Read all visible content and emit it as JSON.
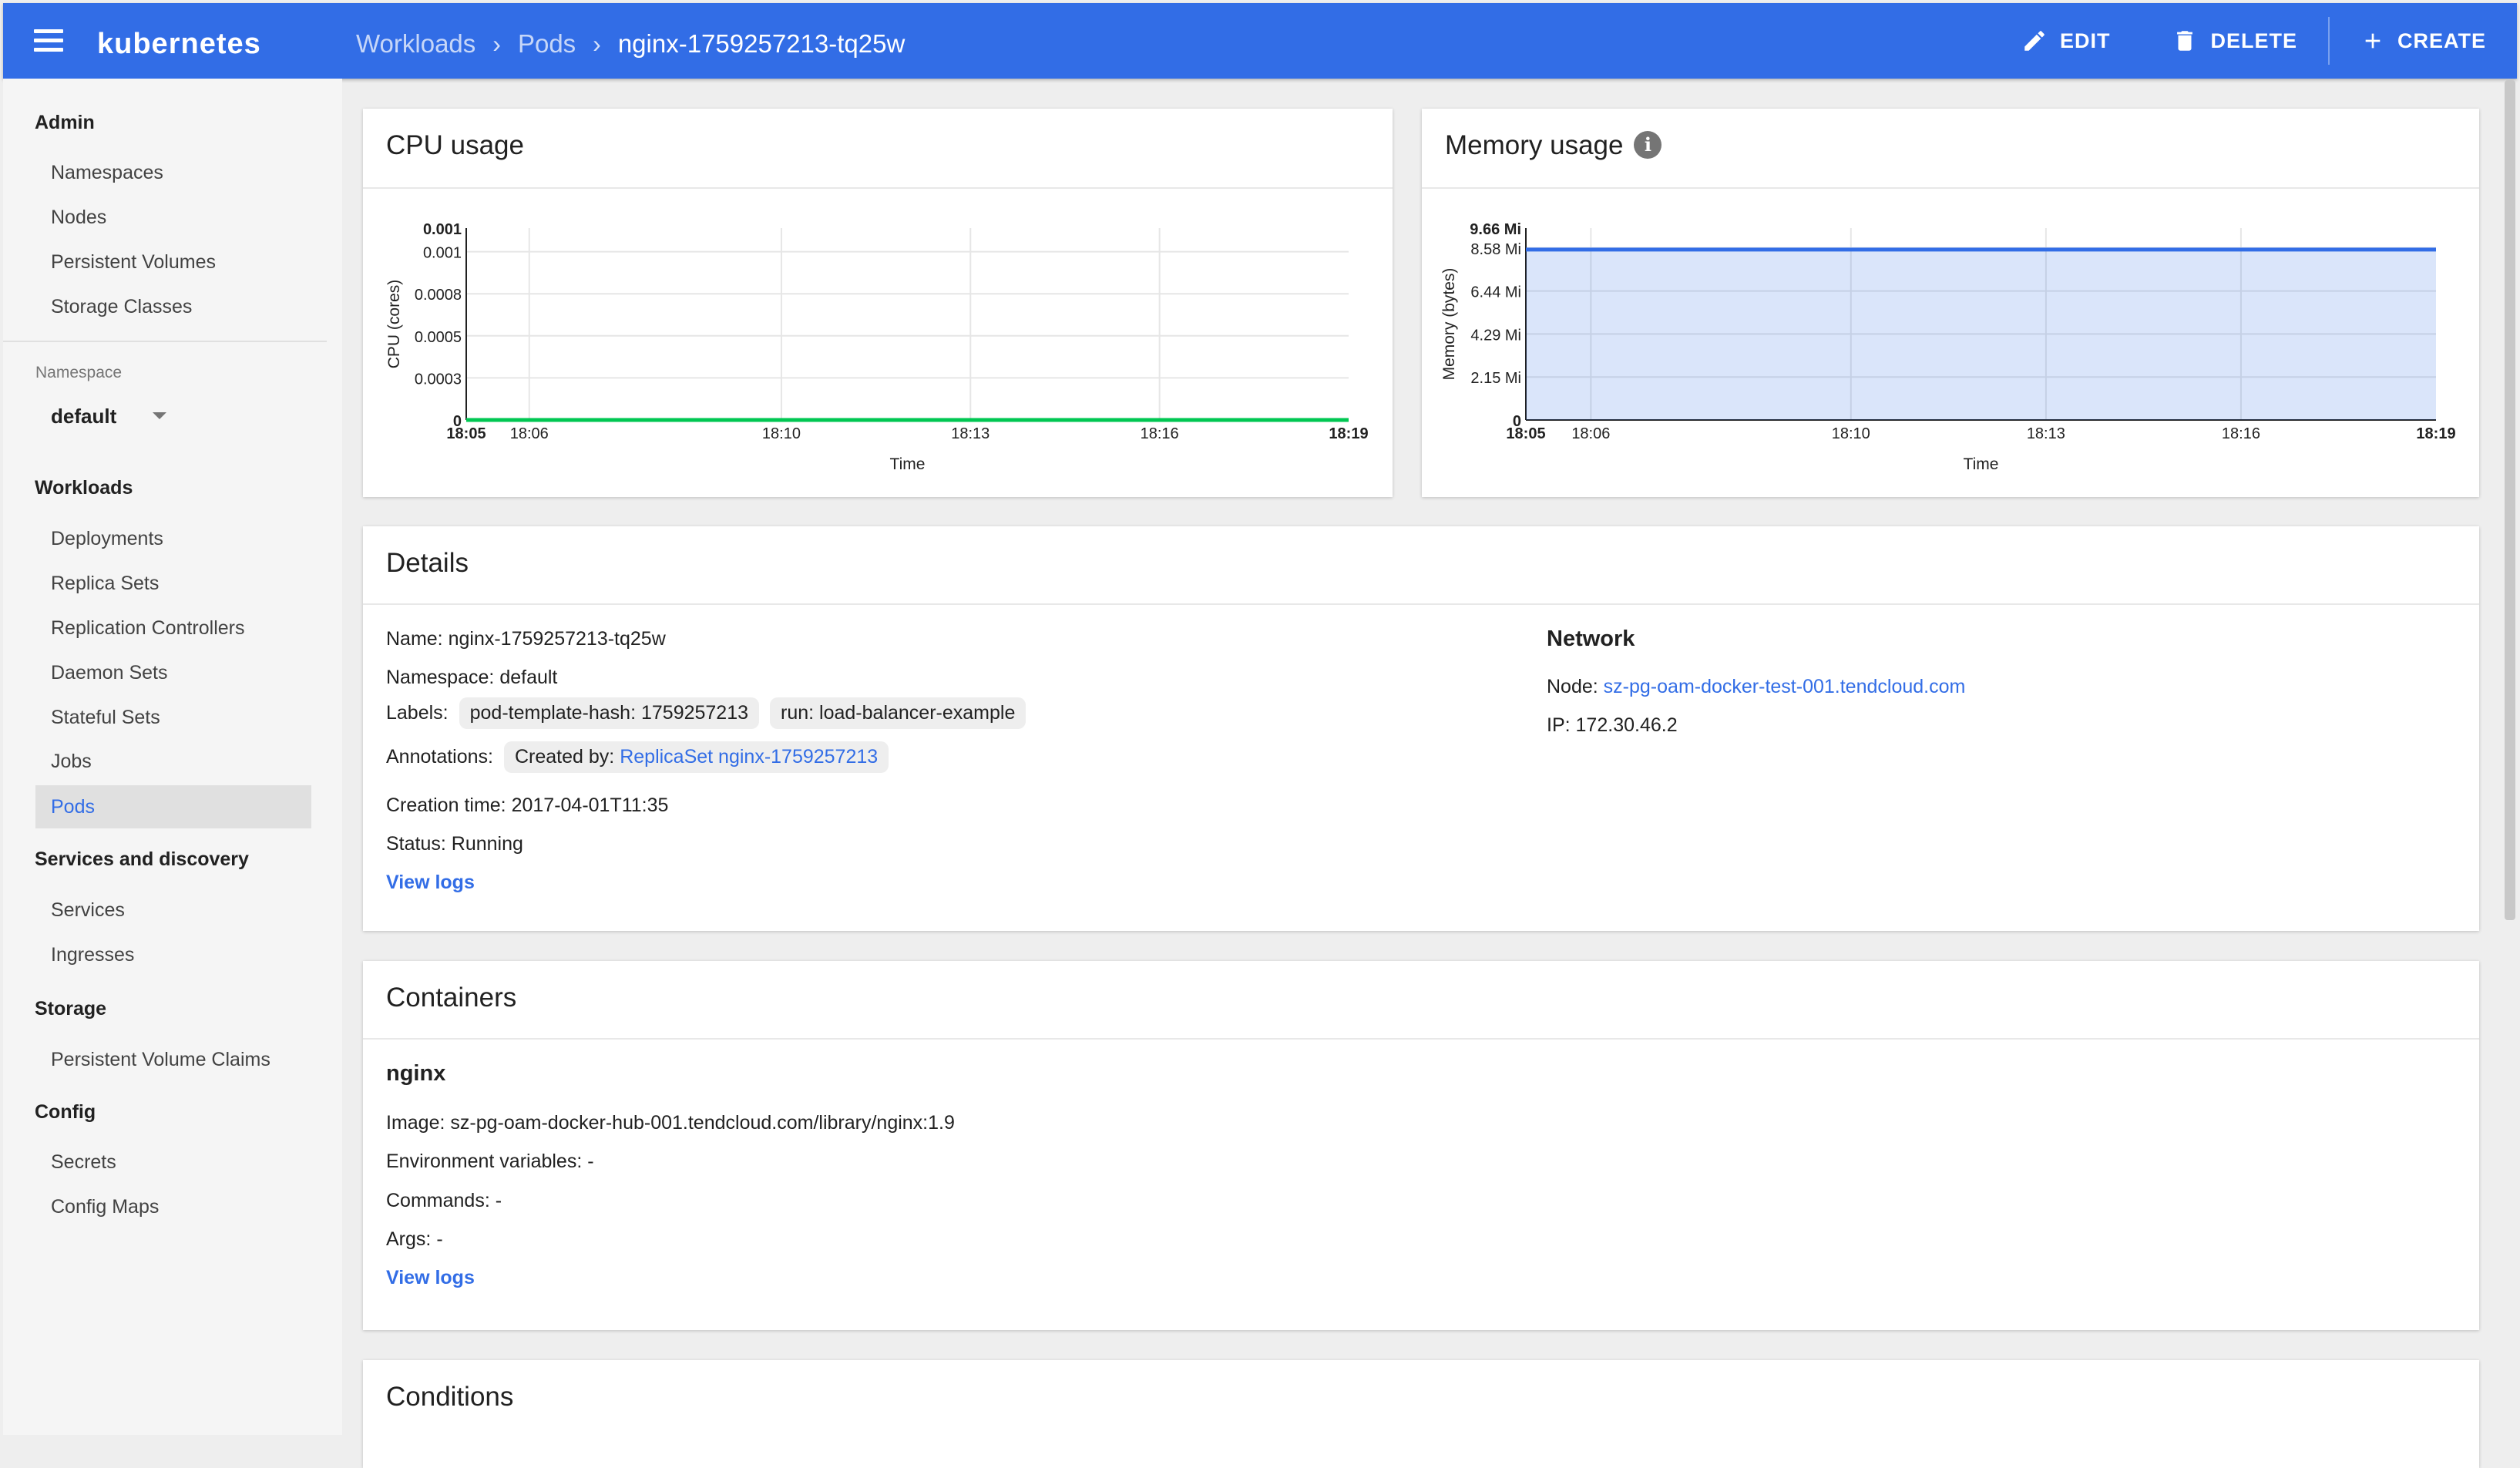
{
  "topbar": {
    "brand": "kubernetes",
    "breadcrumbs": [
      "Workloads",
      "Pods",
      "nginx-1759257213-tq25w"
    ],
    "actions": {
      "edit": "EDIT",
      "delete": "DELETE",
      "create": "CREATE"
    },
    "color": "#326de6"
  },
  "sidebar": {
    "admin": {
      "title": "Admin",
      "items": [
        "Namespaces",
        "Nodes",
        "Persistent Volumes",
        "Storage Classes"
      ]
    },
    "namespace": {
      "label": "Namespace",
      "value": "default"
    },
    "workloads": {
      "title": "Workloads",
      "items": [
        "Deployments",
        "Replica Sets",
        "Replication Controllers",
        "Daemon Sets",
        "Stateful Sets",
        "Jobs",
        "Pods"
      ],
      "active": "Pods"
    },
    "services": {
      "title": "Services and discovery",
      "items": [
        "Services",
        "Ingresses"
      ]
    },
    "storage": {
      "title": "Storage",
      "items": [
        "Persistent Volume Claims"
      ]
    },
    "config": {
      "title": "Config",
      "items": [
        "Secrets",
        "Config Maps"
      ]
    }
  },
  "chart_data": [
    {
      "type": "line",
      "title": "CPU usage",
      "xlabel": "Time",
      "ylabel": "CPU (cores)",
      "x_ticks": [
        "18:05",
        "18:06",
        "18:10",
        "18:13",
        "18:16",
        "18:19"
      ],
      "y_ticks": [
        "0",
        "0.0003",
        "0.0005",
        "0.0008",
        "0.001",
        "0.001"
      ],
      "ylim": [
        0,
        0.001
      ],
      "series": [
        {
          "color": "#00c752",
          "x": [
            "18:05",
            "18:19"
          ],
          "values": [
            0,
            0
          ]
        }
      ]
    },
    {
      "type": "area",
      "title": "Memory usage",
      "xlabel": "Time",
      "ylabel": "Memory (bytes)",
      "x_ticks": [
        "18:05",
        "18:06",
        "18:10",
        "18:13",
        "18:16",
        "18:19"
      ],
      "y_ticks": [
        "0",
        "2.15 Mi",
        "4.29 Mi",
        "6.44 Mi",
        "8.58 Mi",
        "9.66 Mi"
      ],
      "ylim": [
        0,
        9.66
      ],
      "series": [
        {
          "color": "#326de6",
          "x": [
            "18:05",
            "18:19"
          ],
          "values": [
            8.58,
            8.58
          ]
        }
      ]
    }
  ],
  "details": {
    "title": "Details",
    "name_label": "Name:",
    "name": "nginx-1759257213-tq25w",
    "namespace_label": "Namespace:",
    "namespace": "default",
    "labels_label": "Labels:",
    "labels": [
      "pod-template-hash: 1759257213",
      "run: load-balancer-example"
    ],
    "annotations_label": "Annotations:",
    "annotation_prefix": "Created by:",
    "annotation_link": "ReplicaSet nginx-1759257213",
    "creation_label": "Creation time:",
    "creation": "2017-04-01T11:35",
    "status_label": "Status:",
    "status": "Running",
    "view_logs": "View logs",
    "network": {
      "title": "Network",
      "node_label": "Node:",
      "node": "sz-pg-oam-docker-test-001.tendcloud.com",
      "ip_label": "IP:",
      "ip": "172.30.46.2"
    }
  },
  "containers": {
    "title": "Containers",
    "name": "nginx",
    "image_label": "Image:",
    "image": "sz-pg-oam-docker-hub-001.tendcloud.com/library/nginx:1.9",
    "env_label": "Environment variables:",
    "env": "-",
    "commands_label": "Commands:",
    "commands": "-",
    "args_label": "Args:",
    "args": "-",
    "view_logs": "View logs"
  },
  "conditions": {
    "title": "Conditions"
  }
}
